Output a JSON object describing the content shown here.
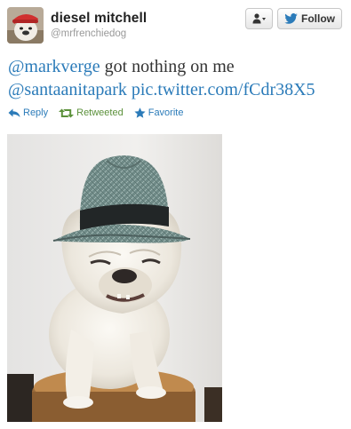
{
  "header": {
    "display_name": "diesel mitchell",
    "screen_name": "@mrfrenchiedog",
    "follow_label": "Follow",
    "user_actions_icon": "user-dropdown-icon",
    "follow_icon": "twitter-bird-icon"
  },
  "tweet": {
    "mention_1": "@markverge",
    "text_1": " got nothing on me",
    "mention_2": "@santaanitapark",
    "link": "pic.twitter.com/fCdr38X5"
  },
  "actions": {
    "reply_label": "Reply",
    "retweeted_label": "Retweeted",
    "favorite_label": "Favorite"
  },
  "colors": {
    "link": "#2b7bb9",
    "retweeted": "#5c913b",
    "muted": "#999999",
    "text": "#333333"
  }
}
